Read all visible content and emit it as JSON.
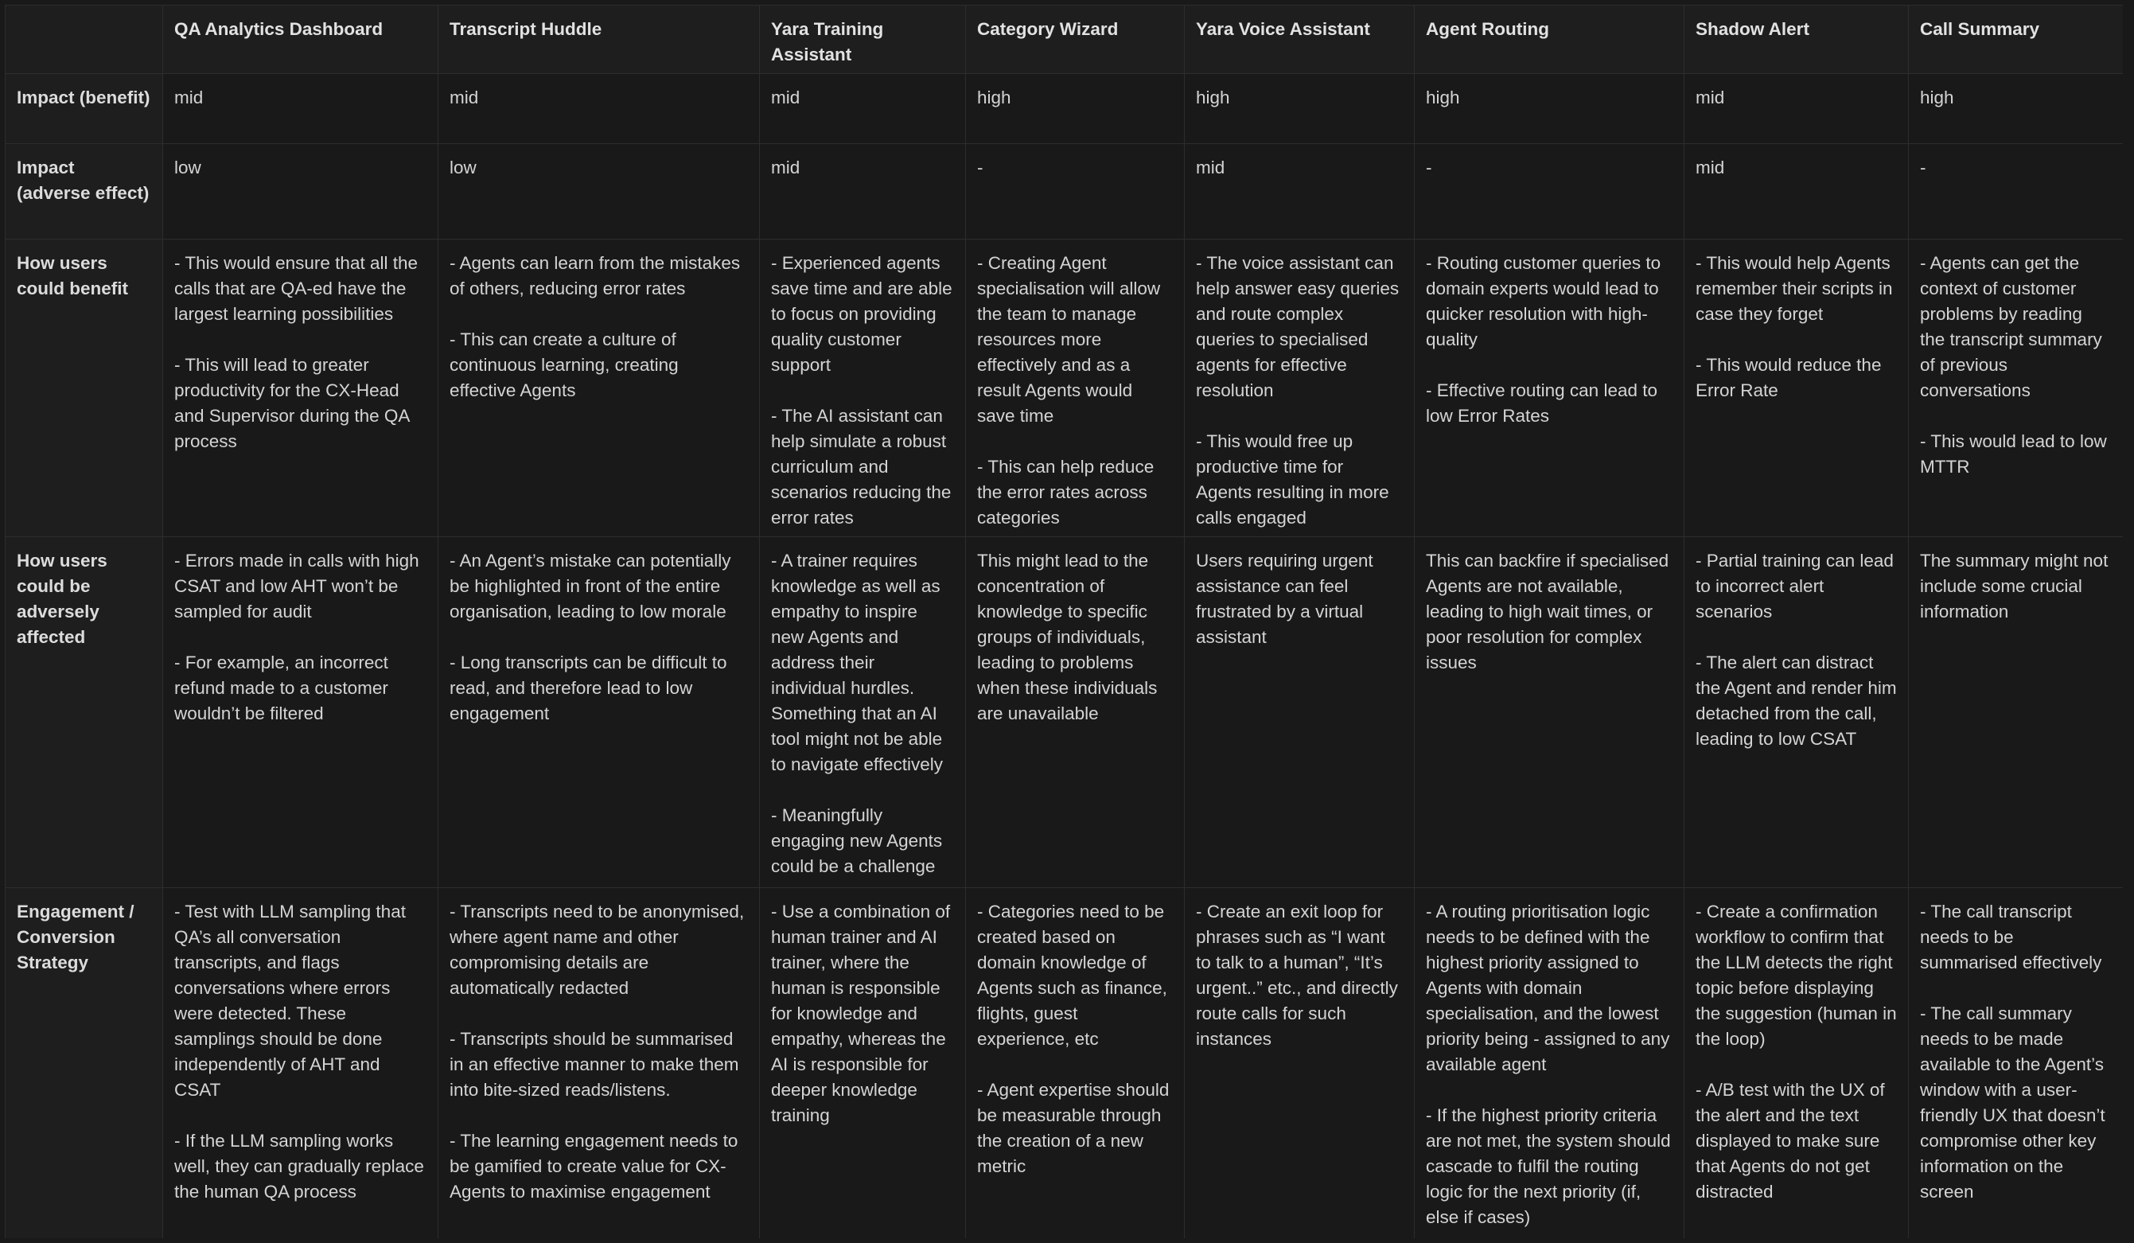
{
  "columns": [
    "QA Analytics Dashboard",
    "Transcript Huddle",
    "Yara Training Assistant",
    "Category Wizard",
    "Yara Voice Assistant",
    "Agent Routing",
    "Shadow Alert",
    "Call Summary"
  ],
  "rows": [
    {
      "label": "Impact (benefit)",
      "cells": [
        [
          "mid"
        ],
        [
          "mid"
        ],
        [
          "mid"
        ],
        [
          "high"
        ],
        [
          "high"
        ],
        [
          "high"
        ],
        [
          "mid"
        ],
        [
          "high"
        ]
      ]
    },
    {
      "label": "Impact (adverse effect)",
      "cells": [
        [
          "low"
        ],
        [
          "low"
        ],
        [
          "mid"
        ],
        [
          "-"
        ],
        [
          "mid"
        ],
        [
          "-"
        ],
        [
          "mid"
        ],
        [
          "-"
        ]
      ]
    },
    {
      "label": "How users could benefit",
      "cells": [
        [
          "- This would ensure that all the calls that are QA-ed have the largest learning possibilities",
          "- This will lead to greater productivity for the CX-Head and Supervisor during the QA process"
        ],
        [
          "- Agents can learn from the mistakes of others, reducing error rates",
          "- This can create a culture of continuous learning, creating effective Agents"
        ],
        [
          "- Experienced agents save time and are able to focus on providing quality customer support",
          "- The AI assistant can help simulate a robust curriculum and scenarios reducing the error rates"
        ],
        [
          "- Creating Agent specialisation will allow the team to manage resources more effectively and as a result Agents would save time",
          "- This can help reduce the error rates across categories"
        ],
        [
          "- The voice assistant can help answer easy queries and route complex queries to specialised agents for effective resolution",
          "- This would free up productive time for Agents resulting in more calls engaged"
        ],
        [
          "- Routing customer queries to domain experts would lead to quicker resolution with high-quality",
          "- Effective routing can lead to low Error Rates"
        ],
        [
          "- This would help Agents remember their scripts in case they forget",
          "- This would reduce the Error Rate"
        ],
        [
          "- Agents can get the context of customer problems by reading the transcript summary of previous conversations",
          "- This would lead to low MTTR"
        ]
      ]
    },
    {
      "label": "How users could be adversely affected",
      "cells": [
        [
          "- Errors made in calls with high CSAT and low AHT won’t be sampled for audit",
          "- For example, an incorrect refund made to a customer wouldn’t be filtered"
        ],
        [
          "- An Agent’s mistake can potentially be highlighted in front of the entire organisation, leading to low morale",
          "- Long transcripts can be difficult to read, and therefore lead to low engagement"
        ],
        [
          "- A trainer requires knowledge as well as empathy to inspire new Agents and address their individual hurdles. Something that an AI tool might not be able to navigate effectively",
          "- Meaningfully engaging new Agents could be a challenge"
        ],
        [
          "This might lead to the concentration of knowledge to specific groups of individuals, leading to problems when these individuals are unavailable"
        ],
        [
          "Users requiring urgent assistance can feel frustrated by a virtual assistant"
        ],
        [
          "This can backfire if specialised Agents are not available, leading to high wait times, or poor resolution for complex issues"
        ],
        [
          "- Partial training can lead to incorrect alert scenarios",
          "- The alert can distract the Agent and render him detached from the call, leading to low CSAT"
        ],
        [
          "The summary might not include some crucial information"
        ]
      ]
    },
    {
      "label": "Engagement / Conversion Strategy",
      "cells": [
        [
          "- Test with LLM sampling that QA’s all conversation transcripts, and flags conversations where errors were detected. These samplings should be done independently of AHT and CSAT",
          "- If the LLM sampling works well, they can gradually replace the human QA process"
        ],
        [
          "- Transcripts need to be anonymised, where agent name and other compromising details are automatically redacted",
          "- Transcripts should be summarised in an effective manner to make them into bite-sized reads/listens.",
          "- The learning engagement needs to be gamified to create value for CX-Agents to maximise engagement"
        ],
        [
          "- Use a combination of human trainer and AI trainer, where the human is responsible for knowledge and empathy, whereas the AI is responsible for deeper knowledge training"
        ],
        [
          "- Categories need to be created based on domain knowledge of Agents such as finance, flights, guest experience, etc",
          "- Agent expertise should be measurable through the creation of a new metric"
        ],
        [
          "- Create an exit loop for phrases such as “I want to talk to a human”, “It’s urgent..” etc., and directly route calls for such instances"
        ],
        [
          "- A routing prioritisation logic needs to be defined with the highest priority assigned to Agents with domain specialisation, and the lowest priority being - assigned to any available agent",
          "- If the highest priority criteria are not met, the system should cascade to fulfil the routing logic for the next priority (if, else if cases)"
        ],
        [
          "- Create a confirmation workflow to confirm that the LLM detects the right topic before displaying the suggestion (human in the loop)",
          "- A/B test with the UX of the alert and the text displayed to make sure that Agents do not get distracted"
        ],
        [
          "- The call transcript needs to be summarised effectively",
          "- The call summary needs to be made available to the Agent’s window with a user-friendly UX that doesn’t compromise other key information on the screen"
        ]
      ]
    }
  ]
}
